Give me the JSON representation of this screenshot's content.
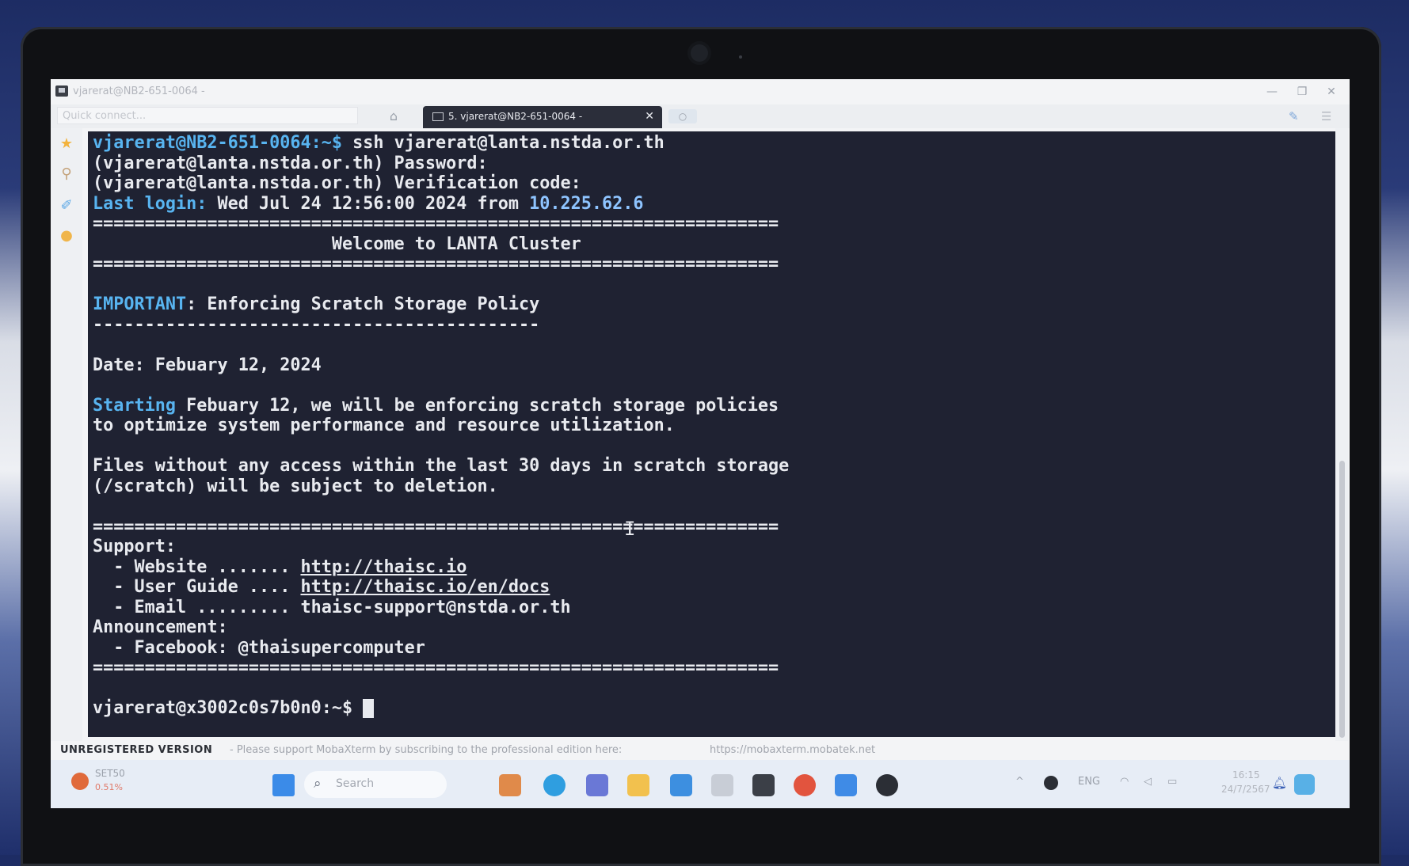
{
  "window": {
    "title": "vjarerat@NB2-651-0064 -",
    "minimize": "—",
    "maximize": "❐",
    "close": "✕"
  },
  "tabs": {
    "quick_connect_placeholder": "Quick connect...",
    "active_tab_label": "5. vjarerat@NB2-651-0064 -",
    "active_tab_close": "✕",
    "new_tab_glyph": "○"
  },
  "terminal": {
    "prompt_local": "vjarerat@NB2-651-0064:~$",
    "ssh_command": " ssh vjarerat@lanta.nstda.or.th",
    "password_prompt": "(vjarerat@lanta.nstda.or.th) Password:",
    "verification_prompt": "(vjarerat@lanta.nstda.or.th) Verification code:",
    "last_login_label": "Last login:",
    "last_login_time": " Wed Jul 24 12:56:00 2024 from ",
    "last_login_ip": "10.225.62.6",
    "separator_eq": "==================================================================",
    "welcome_line": "                       Welcome to LANTA Cluster",
    "important_label": "IMPORTANT",
    "important_text": ": Enforcing Scratch Storage Policy",
    "separator_dash": "-------------------------------------------",
    "date_line": "Date: Febuary 12, 2024",
    "starting_word": "Starting",
    "starting_rest": " Febuary 12, we will be enforcing scratch storage policies",
    "optimize_line": "to optimize system performance and resource utilization.",
    "files_line": "Files without any access within the last 30 days in scratch storage",
    "scratch_line": "(/scratch) will be subject to deletion.",
    "support_label": "Support:",
    "website_prefix": "  - Website ....... ",
    "website_url": "http://thaisc.io",
    "guide_prefix": "  - User Guide .... ",
    "guide_url": "http://thaisc.io/en/docs",
    "email_line": "  - Email ......... thaisc-support@nstda.or.th",
    "announcement_label": "Announcement:",
    "facebook_line": "  - Facebook: @thaisupercomputer",
    "prompt_remote": "vjarerat@x3002c0s7b0n0:~$ ",
    "text_cursor": "I"
  },
  "statusbar": {
    "unregistered": "UNREGISTERED VERSION",
    "support_msg": "-  Please support MobaXterm by subscribing to the professional edition here:",
    "url": "https://mobaxterm.mobatek.net"
  },
  "taskbar": {
    "stock_name": "SET50",
    "stock_value": "0.51%",
    "search_placeholder": "Search",
    "tray_chevron": "^",
    "language": "ENG",
    "time": "16:15",
    "date": "24/7/2567"
  },
  "colors": {
    "terminal_bg": "#1f2232",
    "terminal_fg": "#e8eaef",
    "highlight_blue": "#58b4f0",
    "tab_active_bg": "#2b2e3a"
  }
}
